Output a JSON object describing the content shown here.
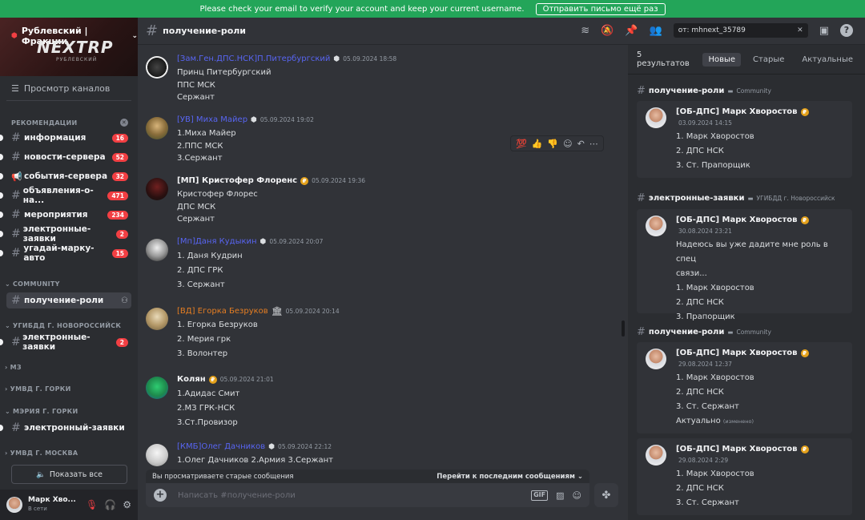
{
  "banner": {
    "text": "Please check your email to verify your account and keep your current username.",
    "button": "Отправить письмо ещё раз"
  },
  "server": {
    "name": "Рублевский | Фракции",
    "logo": "NEXTRP",
    "logo_sub": "РУБЛЕВСКИЙ"
  },
  "sidebar": {
    "browse": "Просмотр каналов",
    "sections": {
      "recommend": "РЕКОМЕНДАЦИИ",
      "community": "COMMUNITY",
      "ugibdd": "УГИБДД Г. НОВОРОССИЙСК",
      "mz": "МЗ",
      "umvd_gorki": "УМВД Г. ГОРКИ",
      "meria": "МЭРИЯ Г. ГОРКИ",
      "umvd_moscow": "УМВД Г. МОСКВА"
    },
    "channels": [
      {
        "name": "информация",
        "badge": "16"
      },
      {
        "name": "новости-сервера",
        "badge": "52"
      },
      {
        "name": "события-сервера",
        "badge": "32"
      },
      {
        "name": "объявления-о-на...",
        "badge": "471"
      },
      {
        "name": "мероприятия",
        "badge": "234"
      },
      {
        "name": "электронные-заявки",
        "badge": "2"
      },
      {
        "name": "угадай-марку-авто",
        "badge": "15"
      },
      {
        "name": "получение-роли",
        "badge": ""
      },
      {
        "name": "электронные-заявки",
        "badge": "2"
      },
      {
        "name": "электронный-заявки",
        "badge": ""
      }
    ],
    "show_all": "Показать все"
  },
  "user": {
    "name": "Марк Хво...",
    "status": "В сети"
  },
  "channel": {
    "title": "получение-роли",
    "search": "от: mhnext_35789"
  },
  "messages": [
    {
      "author": "[Зам.Ген.ДПС.НСК]П.Питербургский",
      "color": "#5865f2",
      "time": "05.09.2024 18:58",
      "lines": [
        "Принц Питербургский",
        "ППС МСК",
        "Сержант"
      ]
    },
    {
      "author": "[УВ] Миха Майер",
      "color": "#5865f2",
      "time": "05.09.2024 19:02",
      "lines": [
        "1.Миха Майер",
        "2.ППС МСК",
        "3.Сержант"
      ]
    },
    {
      "author": "[МП] Кристофер Флоренс",
      "color": "#f2f3f5",
      "time": "05.09.2024 19:36",
      "lines": [
        "Кристофер Флорес",
        "ДПС МСК",
        "Сержант"
      ]
    },
    {
      "author": "[Мп]Даня Кудыкин",
      "color": "#5865f2",
      "time": "05.09.2024 20:07",
      "lines": [
        "1. Даня Кудрин",
        "2. ДПС ГРК",
        "3. Сержант"
      ]
    },
    {
      "author": "[ВД] Егорка Безруков",
      "color": "#e67e22",
      "time": "05.09.2024 20:14",
      "lines": [
        "1. Егорка Безруков",
        "2. Мерия грк",
        "3. Волонтер"
      ]
    },
    {
      "author": "Колян",
      "color": "#f2f3f5",
      "time": "05.09.2024 21:01",
      "lines": [
        "1.Адидас Смит",
        "2.МЗ ГРК-НСК",
        "3.Ст.Провизор"
      ]
    },
    {
      "author": "[КМБ]Олег Дачников",
      "color": "#5865f2",
      "time": "05.09.2024 22:12",
      "lines": [
        "1.Олег Дачников 2.Армия 3.Сержант"
      ]
    }
  ],
  "reactions": [
    "💯",
    "👍",
    "👎"
  ],
  "old_bar": {
    "text": "Вы просматриваете старые сообщения",
    "jump": "Перейти к последним сообщениям"
  },
  "composer": {
    "placeholder": "Написать #получение-роли"
  },
  "results": {
    "count": "5 результатов",
    "tabs": [
      "Новые",
      "Старые",
      "Актуальные"
    ],
    "groups": [
      {
        "channel": "получение-роли",
        "category": "Community"
      },
      {
        "channel": "электронные-заявки",
        "category": "УГИБДД г. Новороссийск"
      },
      {
        "channel": "получение-роли",
        "category": "Community"
      }
    ],
    "cards": [
      {
        "author": "[ОБ-ДПС] Марк Хворостов",
        "time": "03.09.2024 14:15",
        "lines": [
          "1. Марк Хворостов",
          "2. ДПС НСК",
          "3. Ст. Прапорщик"
        ]
      },
      {
        "author": "[ОБ-ДПС] Марк Хворостов",
        "time": "30.08.2024 23:21",
        "lines": [
          "Надеюсь вы уже дадите мне роль в спец",
          "связи...",
          "1. Марк Хворостов",
          "2. ДПС НСК",
          "3. Прапорщик"
        ]
      },
      {
        "author": "[ОБ-ДПС] Марк Хворостов",
        "time": "29.08.2024 12:37",
        "lines": [
          "1. Марк Хворостов",
          "2. ДПС НСК",
          "3. Ст. Сержант",
          "Актуально"
        ],
        "edited": "(изменено)"
      },
      {
        "author": "[ОБ-ДПС] Марк Хворостов",
        "time": "29.08.2024 2:29",
        "lines": [
          "1. Марк Хворостов",
          "2. ДПС НСК",
          "3. Ст. Сержант"
        ]
      }
    ]
  },
  "colors": {
    "accent": "#5865f2",
    "badge": "#f23f43",
    "banner": "#23a559",
    "booster": "#e4a11b"
  }
}
